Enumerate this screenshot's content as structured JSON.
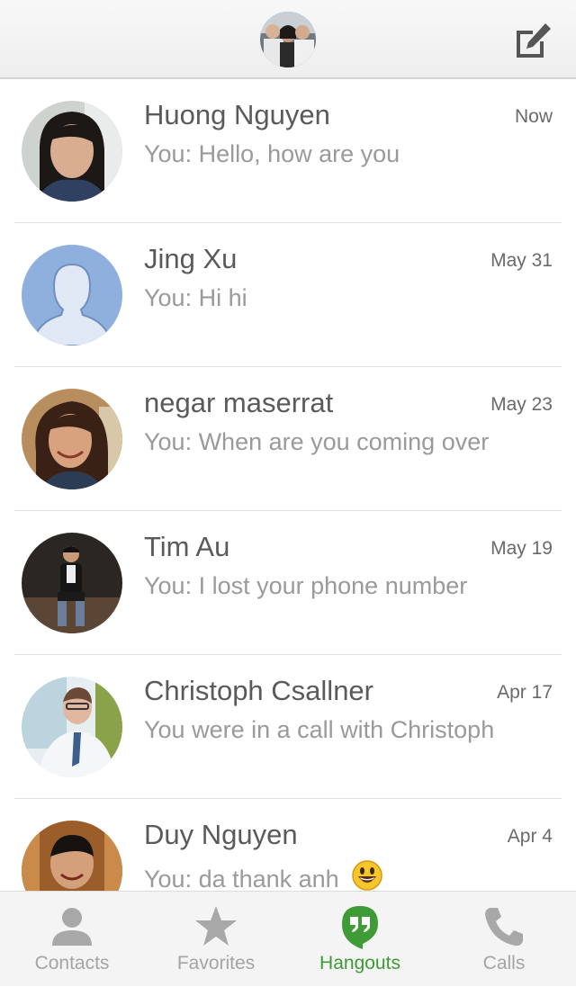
{
  "header": {
    "profile_avatar_alt": "profile-photo",
    "compose_icon": "compose-icon"
  },
  "conversations": [
    {
      "name": "Huong Nguyen",
      "time": "Now",
      "message": "You: Hello, how are you",
      "avatar": "photo"
    },
    {
      "name": "Jing Xu",
      "time": "May 31",
      "message": "You: Hi hi",
      "avatar": "default-silhouette"
    },
    {
      "name": "negar maserrat",
      "time": "May 23",
      "message": "You: When are you coming over",
      "avatar": "photo"
    },
    {
      "name": "Tim Au",
      "time": "May 19",
      "message": "You: I lost your phone number",
      "avatar": "photo"
    },
    {
      "name": "Christoph Csallner",
      "time": "Apr 17",
      "message": "You were in a call with Christoph",
      "avatar": "photo"
    },
    {
      "name": "Duy Nguyen",
      "time": "Apr 4",
      "message": "You: da thank anh",
      "avatar": "photo",
      "emoji": "smiley-emoji"
    }
  ],
  "bottom_nav": [
    {
      "label": "Contacts",
      "icon": "person-icon",
      "active": false
    },
    {
      "label": "Favorites",
      "icon": "star-icon",
      "active": false
    },
    {
      "label": "Hangouts",
      "icon": "hangouts-icon",
      "active": true
    },
    {
      "label": "Calls",
      "icon": "phone-icon",
      "active": false
    }
  ],
  "colors": {
    "active": "#3f9b36",
    "inactive": "#a4a4a4",
    "default_avatar_bg": "#8fb0dc"
  }
}
